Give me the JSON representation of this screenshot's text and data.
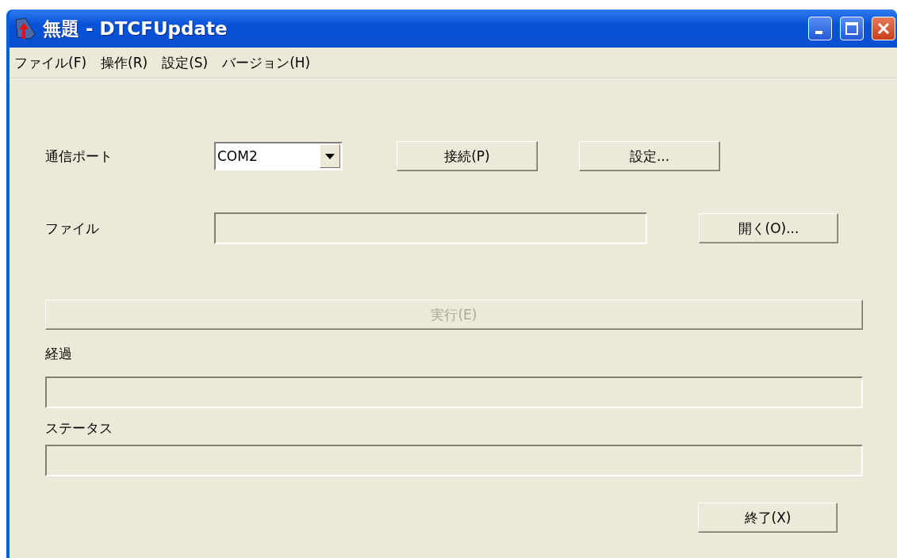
{
  "window": {
    "title": "無題 - DTCFUpdate"
  },
  "menu": [
    {
      "label": "ファイル(F)"
    },
    {
      "label": "操作(R)"
    },
    {
      "label": "設定(S)"
    },
    {
      "label": "バージョン(H)"
    }
  ],
  "port": {
    "label": "通信ポート",
    "value": "COM2",
    "connect_button": "接続(P)",
    "settings_button": "設定..."
  },
  "file": {
    "label": "ファイル",
    "open_button": "開く(O)..."
  },
  "execute_button": {
    "label": "実行(E)",
    "disabled": true
  },
  "progress": {
    "label": "経過"
  },
  "status": {
    "label": "ステータス"
  },
  "exit_button": {
    "label": "終了(X)"
  }
}
